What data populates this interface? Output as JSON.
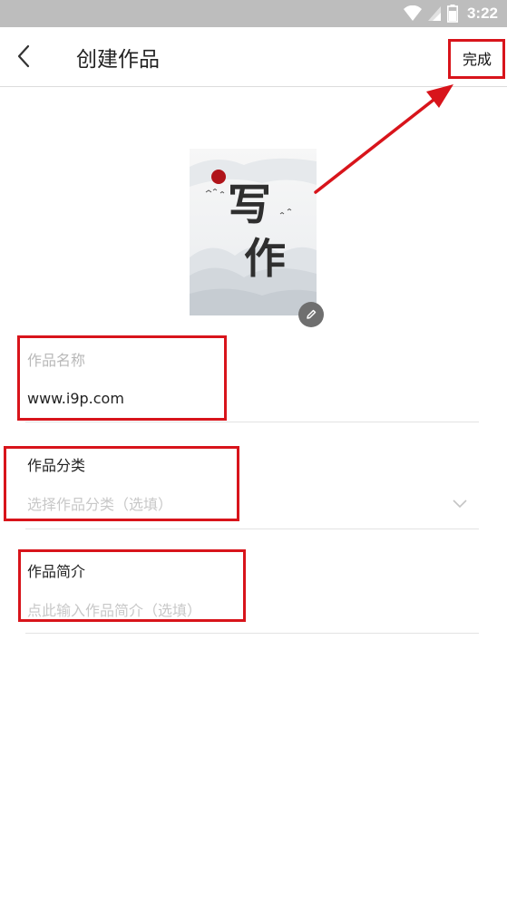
{
  "status_bar": {
    "time": "3:22"
  },
  "header": {
    "title": "创建作品",
    "done_label": "完成"
  },
  "cover": {
    "title_chars": [
      "写",
      "作"
    ]
  },
  "form": {
    "name": {
      "label": "作品名称",
      "value": "www.i9p.com"
    },
    "category": {
      "label": "作品分类",
      "placeholder": "选择作品分类（选填）"
    },
    "intro": {
      "label": "作品简介",
      "placeholder": "点此输入作品简介（选填）"
    }
  },
  "colors": {
    "annotation": "#d8141b",
    "status_bar": "#bdbdbd",
    "sun": "#b0141a"
  },
  "icons": {
    "back": "back-arrow-icon",
    "edit": "pencil-icon",
    "chevron": "chevron-down-icon",
    "wifi": "wifi-icon",
    "signal": "signal-icon",
    "battery": "battery-icon"
  }
}
